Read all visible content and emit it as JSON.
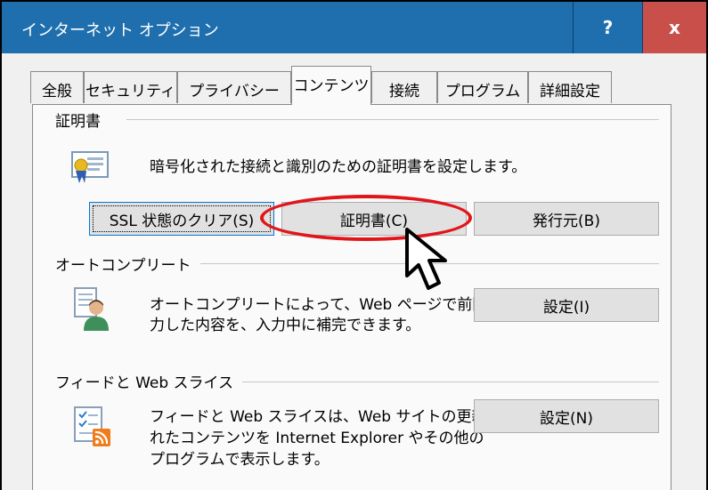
{
  "window": {
    "title": "インターネット オプション",
    "help_label": "?",
    "close_label": "x"
  },
  "tabs": [
    {
      "label": "全般"
    },
    {
      "label": "セキュリティ"
    },
    {
      "label": "プライバシー"
    },
    {
      "label": "コンテンツ",
      "active": true
    },
    {
      "label": "接続"
    },
    {
      "label": "プログラム"
    },
    {
      "label": "詳細設定"
    }
  ],
  "certificates": {
    "heading": "証明書",
    "description": "暗号化された接続と識別のための証明書を設定します。",
    "ssl_button": "SSL 状態のクリア(S)",
    "cert_button": "証明書(C)",
    "publisher_button": "発行元(B)",
    "icon": "certificate-icon"
  },
  "autocomplete": {
    "heading": "オートコンプリート",
    "description_line1": "オートコンプリートによって、Web ページで前回入",
    "description_line2": "力した内容を、入力中に補完できます。",
    "settings_button": "設定(I)",
    "icon": "autocomplete-user-icon"
  },
  "feeds": {
    "heading": "フィードと Web スライス",
    "description_line1": "フィードと Web スライスは、Web サイトの更新さ",
    "description_line2": "れたコンテンツを Internet Explorer やその他の",
    "description_line3": "プログラムで表示します。",
    "settings_button": "設定(N)",
    "icon": "feeds-rss-icon"
  },
  "colors": {
    "titlebar": "#1f6fae",
    "close": "#c9504a",
    "highlight": "#e0161b"
  }
}
